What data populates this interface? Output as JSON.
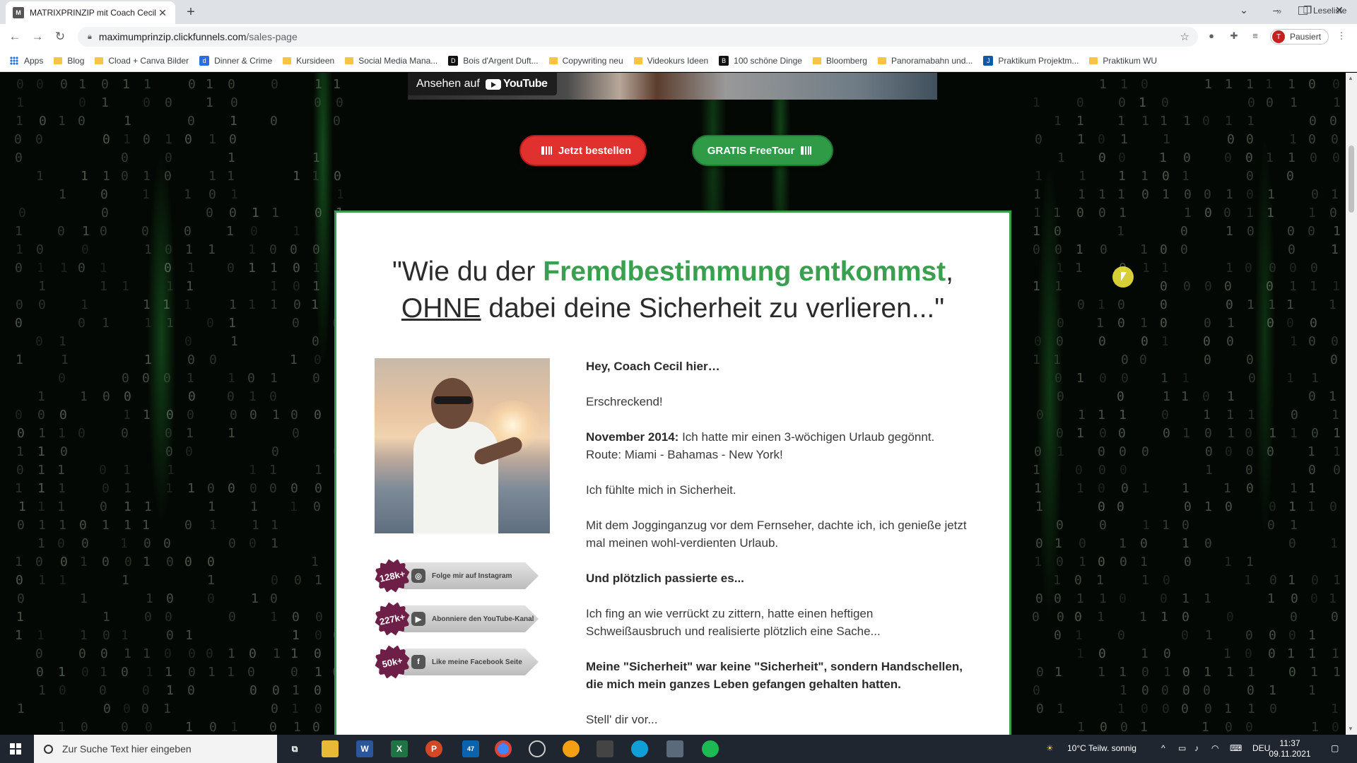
{
  "browser": {
    "tab_title": "MATRIXPRINZIP mit Coach Cecil",
    "tab_close": "✕",
    "new_tab": "+",
    "url_host": "maximumprinzip.clickfunnels.com",
    "url_path": "/sales-page",
    "profile_initial": "T",
    "profile_status": "Pausiert",
    "bookmarks": [
      {
        "label": "Apps",
        "kind": "apps"
      },
      {
        "label": "Blog",
        "kind": "folder"
      },
      {
        "label": "Cload + Canva Bilder",
        "kind": "folder"
      },
      {
        "label": "Dinner & Crime",
        "kind": "site",
        "glyph": "d",
        "color": "#2d6cdf"
      },
      {
        "label": "Kursideen",
        "kind": "folder"
      },
      {
        "label": "Social Media Mana...",
        "kind": "folder"
      },
      {
        "label": "Bois d'Argent Duft...",
        "kind": "site",
        "glyph": "D",
        "color": "#111111"
      },
      {
        "label": "Copywriting neu",
        "kind": "folder"
      },
      {
        "label": "Videokurs Ideen",
        "kind": "folder"
      },
      {
        "label": "100 schöne Dinge",
        "kind": "site",
        "glyph": "B",
        "color": "#111111"
      },
      {
        "label": "Bloomberg",
        "kind": "folder"
      },
      {
        "label": "Panoramabahn und...",
        "kind": "folder"
      },
      {
        "label": "Praktikum Projektm...",
        "kind": "site",
        "glyph": "J",
        "color": "#1457a6"
      },
      {
        "label": "Praktikum WU",
        "kind": "folder"
      }
    ],
    "bookmarks_more": "»",
    "reading_list": "Leseliste"
  },
  "page": {
    "video_watch_label": "Ansehen auf",
    "video_brand": "YouTube",
    "order_button": "Jetzt bestellen",
    "tour_button": "GRATIS FreeTour",
    "headline": {
      "part1": "\"Wie du der ",
      "highlight": "Fremdbestimmung entkommst",
      "part2": ",",
      "underline": "OHNE",
      "part3": " dabei deine Sicherheit zu verlieren...\""
    },
    "social": [
      {
        "count": "128k+",
        "label": "Folge mir auf Instagram",
        "icon": "instagram-icon",
        "glyph": "◎",
        "color": "#555555"
      },
      {
        "count": "227k+",
        "label": "Abonniere den YouTube-Kanal",
        "icon": "youtube-icon",
        "glyph": "▶",
        "color": "#555555"
      },
      {
        "count": "50k+",
        "label": "Like meine Facebook Seite",
        "icon": "facebook-icon",
        "glyph": "f",
        "color": "#555555"
      }
    ],
    "copy": {
      "greeting": "Hey, Coach Cecil hier…",
      "p1": "Erschreckend!",
      "p2_bold": "November 2014:",
      "p2_rest": " Ich hatte mir einen 3-wöchigen Urlaub gegönnt.",
      "p2_line2": "Route: Miami - Bahamas - New York!",
      "p3": "Ich fühlte mich in Sicherheit.",
      "p4": "Mit dem Jogginganzug vor dem Fernseher, dachte ich, ich genieße jetzt mal meinen wohl-verdienten Urlaub.",
      "p5": "Und plötzlich passierte es...",
      "p6": "Ich fing an wie verrückt zu zittern, hatte einen heftigen Schweißausbruch und realisierte plötzlich eine Sache...",
      "p7": "Meine \"Sicherheit\" war keine \"Sicherheit\", sondern Handschellen, die mich mein ganzes Leben gefangen gehalten hatten.",
      "p8": "Stell' dir vor..."
    }
  },
  "taskbar": {
    "search_placeholder": "Zur Suche Text hier eingeben",
    "weather": "10°C  Teilw. sonnig",
    "language": "DEU",
    "time": "11:37",
    "date": "09.11.2021",
    "mail_badge": "47"
  },
  "colors": {
    "accent_green": "#3aa050",
    "order_red": "#e0312e",
    "tour_green": "#2f9b47"
  }
}
